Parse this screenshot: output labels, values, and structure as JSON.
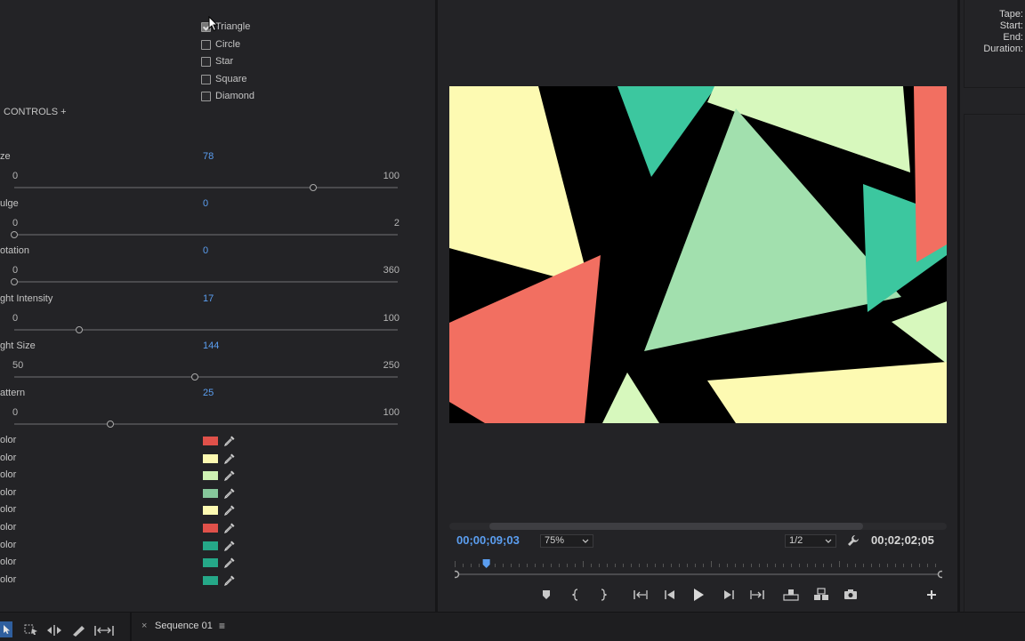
{
  "shapes": [
    {
      "label": "Triangle",
      "checked": true
    },
    {
      "label": "Circle",
      "checked": false
    },
    {
      "label": "Star",
      "checked": false
    },
    {
      "label": "Square",
      "checked": false
    },
    {
      "label": "Diamond",
      "checked": false
    }
  ],
  "controls_header": "CONTROLS +",
  "params": [
    {
      "label": "ze",
      "value": "78",
      "min": "0",
      "max": "100",
      "level": 0.78
    },
    {
      "label": "ulge",
      "value": "0",
      "min": "0",
      "max": "2",
      "level": 0
    },
    {
      "label": "otation",
      "value": "0",
      "min": "0",
      "max": "360",
      "level": 0
    },
    {
      "label": "ght Intensity",
      "value": "17",
      "min": "0",
      "max": "100",
      "level": 0.17
    },
    {
      "label": "ght Size",
      "value": "144",
      "min": "50",
      "max": "250",
      "level": 0.47
    },
    {
      "label": "attern",
      "value": "25",
      "min": "0",
      "max": "100",
      "level": 0.25
    }
  ],
  "colors": [
    {
      "label": "olor",
      "swatch": "#e0514a"
    },
    {
      "label": "olor",
      "swatch": "#fdfab2"
    },
    {
      "label": "olor",
      "swatch": "#cef2b4"
    },
    {
      "label": "olor",
      "swatch": "#86c79b"
    },
    {
      "label": "olor",
      "swatch": "#fdfab2"
    },
    {
      "label": "olor",
      "swatch": "#e0514a"
    },
    {
      "label": "olor",
      "swatch": "#25a888"
    },
    {
      "label": "olor",
      "swatch": "#25a888"
    },
    {
      "label": "olor",
      "swatch": "#25a888"
    }
  ],
  "monitor": {
    "current_timecode": "00;00;09;03",
    "zoom": "75%",
    "resolution": "1/2",
    "duration_timecode": "00;02;02;05",
    "playhead_fraction": 0.065
  },
  "info": {
    "tape": "Tape:",
    "start": "Start:",
    "end": "End:",
    "duration": "Duration:"
  },
  "timeline": {
    "sequence_tab": "Sequence 01"
  },
  "palette": {
    "accent": "#5b9ef0",
    "preview_red": "#f26f61",
    "preview_yellow": "#fdfab2",
    "preview_lightgreen": "#d7f8bd",
    "preview_mint": "#a2e0ae",
    "preview_teal": "#3cc79f"
  }
}
